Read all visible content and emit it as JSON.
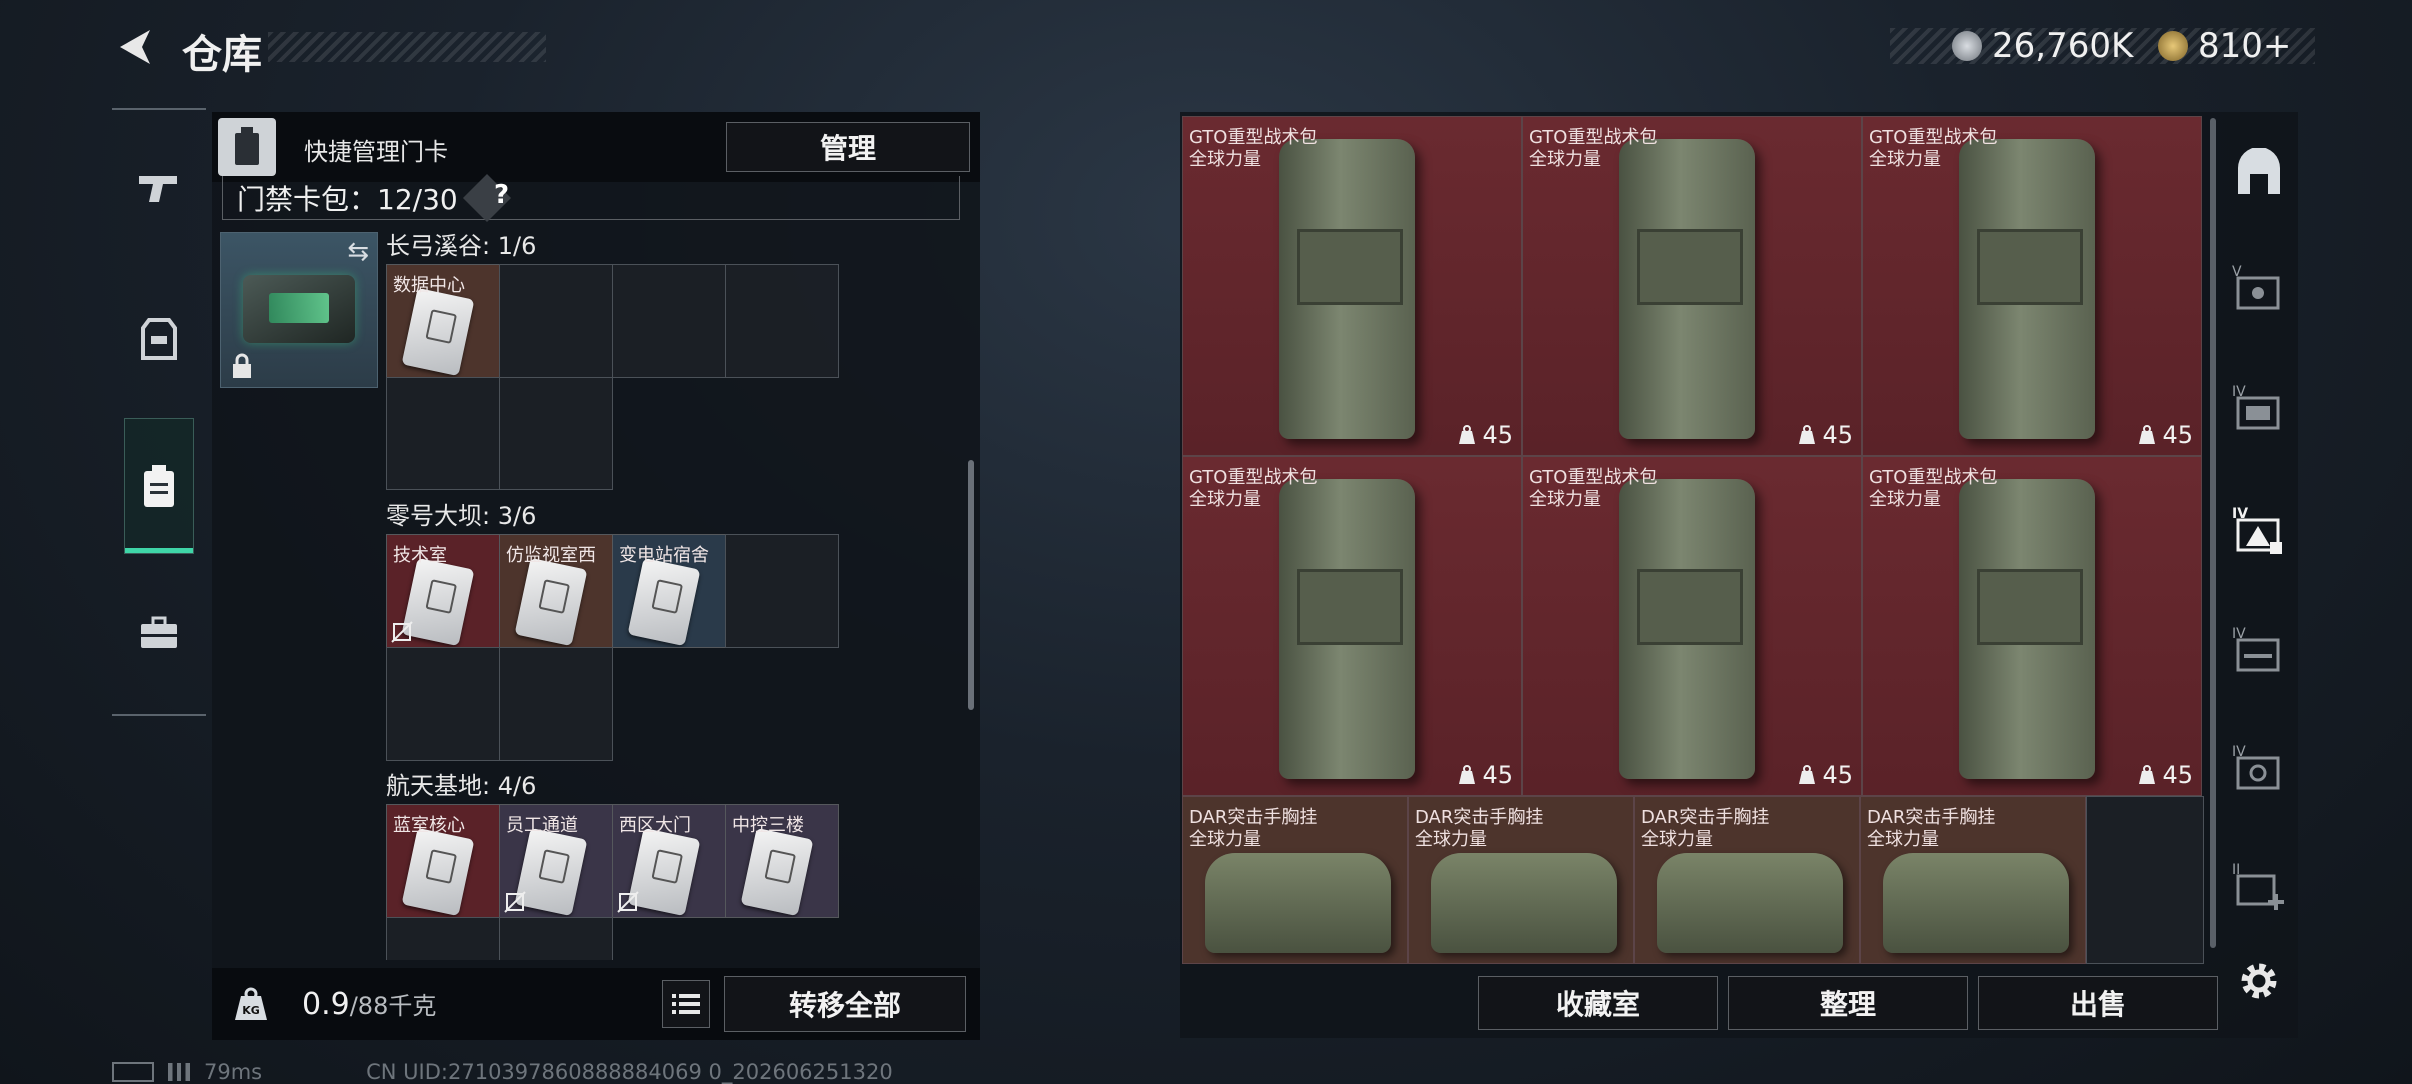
{
  "header": {
    "title": "仓库",
    "currency_primary": "26,760K",
    "currency_secondary": "810+"
  },
  "keycard_panel": {
    "title": "快捷管理门卡",
    "manage_button": "管理",
    "capacity_label": "门禁卡包：12/30",
    "help": "?",
    "groups": [
      {
        "name": "长弓溪谷: 1/6",
        "cards": [
          "数据中心"
        ]
      },
      {
        "name": "零号大坝: 3/6",
        "cards": [
          "技术室",
          "仿监视室西",
          "变电站宿舍"
        ]
      },
      {
        "name": "航天基地: 4/6",
        "cards": [
          "蓝室核心",
          "员工通道",
          "西区大门",
          "中控三楼"
        ]
      }
    ],
    "weight_icon": "KG",
    "weight": "0.9",
    "weight_max": "/88千克",
    "transfer_all": "转移全部"
  },
  "inventory": {
    "items": [
      {
        "name": "GTO重型战术包",
        "sub": "全球力量",
        "weight": "45",
        "kind": "backpack"
      },
      {
        "name": "GTO重型战术包",
        "sub": "全球力量",
        "weight": "45",
        "kind": "backpack"
      },
      {
        "name": "GTO重型战术包",
        "sub": "全球力量",
        "weight": "45",
        "kind": "backpack"
      },
      {
        "name": "GTO重型战术包",
        "sub": "全球力量",
        "weight": "45",
        "kind": "backpack"
      },
      {
        "name": "GTO重型战术包",
        "sub": "全球力量",
        "weight": "45",
        "kind": "backpack"
      },
      {
        "name": "GTO重型战术包",
        "sub": "全球力量",
        "weight": "45",
        "kind": "backpack"
      },
      {
        "name": "DAR突击手胸挂",
        "sub": "全球力量",
        "kind": "rig"
      },
      {
        "name": "DAR突击手胸挂",
        "sub": "全球力量",
        "kind": "rig"
      },
      {
        "name": "DAR突击手胸挂",
        "sub": "全球力量",
        "kind": "rig"
      },
      {
        "name": "DAR突击手胸挂",
        "sub": "全球力量",
        "kind": "rig"
      }
    ],
    "buttons": {
      "collection": "收藏室",
      "sort": "整理",
      "sell": "出售"
    }
  },
  "right_sidebar": {
    "tier_labels": [
      "V",
      "IV",
      "IV",
      "IV",
      "IV",
      "II"
    ]
  },
  "status": {
    "ping": "79ms",
    "uid": "CN UID:2710397860888884069 0_202606251320"
  },
  "colors": {
    "accent": "#3fd6a8",
    "card_red": "#5a2228",
    "card_brown": "#4d342c",
    "card_blue": "#2a3a4a",
    "card_violet": "#3a3548"
  }
}
